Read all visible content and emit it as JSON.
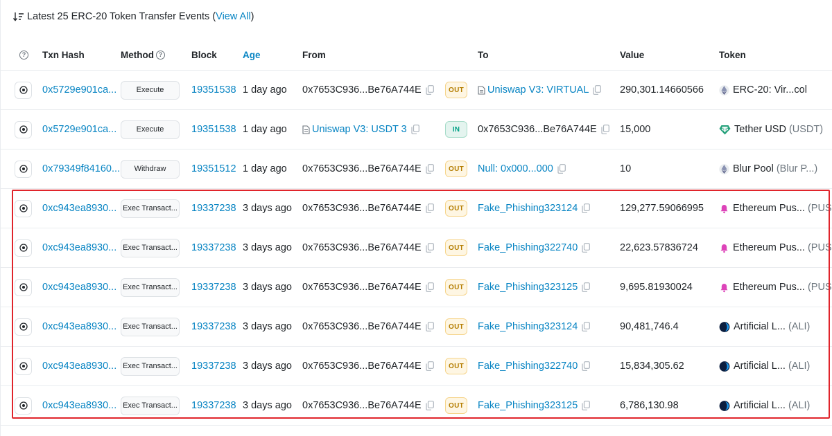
{
  "title": {
    "text": "Latest 25 ERC-20 Token Transfer Events (",
    "link": "View All",
    "suffix": ")"
  },
  "columns": {
    "txn_hash": "Txn Hash",
    "method": "Method",
    "block": "Block",
    "age": "Age",
    "from": "From",
    "to": "To",
    "value": "Value",
    "token": "Token"
  },
  "rows": [
    {
      "hash": "0x5729e901ca...",
      "method": "Execute",
      "block": "19351538",
      "age": "1 day ago",
      "from": "0x7653C936...Be76A744E",
      "from_contract": false,
      "direction": "OUT",
      "to": "Uniswap V3: VIRTUAL",
      "to_contract": true,
      "value": "290,301.14660566",
      "token_name": "ERC-20: Vir...col",
      "token_symbol": "",
      "token_icon": "eth-diamond-icon"
    },
    {
      "hash": "0x5729e901ca...",
      "method": "Execute",
      "block": "19351538",
      "age": "1 day ago",
      "from": "Uniswap V3: USDT 3",
      "from_contract": true,
      "direction": "IN",
      "to": "0x7653C936...Be76A744E",
      "to_contract": false,
      "value": "15,000",
      "token_name": "Tether USD",
      "token_symbol": "(USDT)",
      "token_icon": "tether-icon"
    },
    {
      "hash": "0x79349f84160...",
      "method": "Withdraw",
      "block": "19351512",
      "age": "1 day ago",
      "from": "0x7653C936...Be76A744E",
      "from_contract": false,
      "direction": "OUT",
      "to": "Null: 0x000...000",
      "to_contract": false,
      "value": "10",
      "token_name": "Blur Pool",
      "token_symbol": "(Blur P...)",
      "token_icon": "eth-diamond-icon"
    },
    {
      "hash": "0xc943ea8930...",
      "method": "Exec Transact...",
      "block": "19337238",
      "age": "3 days ago",
      "from": "0x7653C936...Be76A744E",
      "from_contract": false,
      "direction": "OUT",
      "to": "Fake_Phishing323124",
      "to_contract": false,
      "value": "129,277.59066995",
      "token_name": "Ethereum Pus...",
      "token_symbol": "(PUSH)",
      "token_icon": "push-bell-icon"
    },
    {
      "hash": "0xc943ea8930...",
      "method": "Exec Transact...",
      "block": "19337238",
      "age": "3 days ago",
      "from": "0x7653C936...Be76A744E",
      "from_contract": false,
      "direction": "OUT",
      "to": "Fake_Phishing322740",
      "to_contract": false,
      "value": "22,623.57836724",
      "token_name": "Ethereum Pus...",
      "token_symbol": "(PUSH)",
      "token_icon": "push-bell-icon"
    },
    {
      "hash": "0xc943ea8930...",
      "method": "Exec Transact...",
      "block": "19337238",
      "age": "3 days ago",
      "from": "0x7653C936...Be76A744E",
      "from_contract": false,
      "direction": "OUT",
      "to": "Fake_Phishing323125",
      "to_contract": false,
      "value": "9,695.81930024",
      "token_name": "Ethereum Pus...",
      "token_symbol": "(PUSH)",
      "token_icon": "push-bell-icon"
    },
    {
      "hash": "0xc943ea8930...",
      "method": "Exec Transact...",
      "block": "19337238",
      "age": "3 days ago",
      "from": "0x7653C936...Be76A744E",
      "from_contract": false,
      "direction": "OUT",
      "to": "Fake_Phishing323124",
      "to_contract": false,
      "value": "90,481,746.4",
      "token_name": "Artificial L...",
      "token_symbol": "(ALI)",
      "token_icon": "ali-icon"
    },
    {
      "hash": "0xc943ea8930...",
      "method": "Exec Transact...",
      "block": "19337238",
      "age": "3 days ago",
      "from": "0x7653C936...Be76A744E",
      "from_contract": false,
      "direction": "OUT",
      "to": "Fake_Phishing322740",
      "to_contract": false,
      "value": "15,834,305.62",
      "token_name": "Artificial L...",
      "token_symbol": "(ALI)",
      "token_icon": "ali-icon"
    },
    {
      "hash": "0xc943ea8930...",
      "method": "Exec Transact...",
      "block": "19337238",
      "age": "3 days ago",
      "from": "0x7653C936...Be76A744E",
      "from_contract": false,
      "direction": "OUT",
      "to": "Fake_Phishing323125",
      "to_contract": false,
      "value": "6,786,130.98",
      "token_name": "Artificial L...",
      "token_symbol": "(ALI)",
      "token_icon": "ali-icon"
    }
  ],
  "colors": {
    "link": "#0784c3",
    "highlight_border": "#e0242b",
    "out_badge": "#fef6e3",
    "in_badge": "#e4f4ef"
  }
}
